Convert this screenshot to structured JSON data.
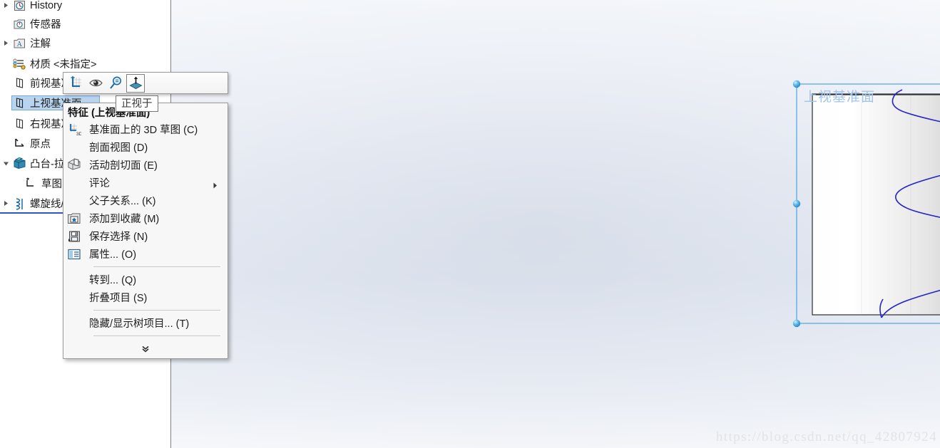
{
  "app": {
    "accent_blue": "#2a56c6",
    "selection_blue": "#b8d5f0",
    "plane_label_color": "#9fc5ee",
    "helix_color": "#2222cc"
  },
  "feature_tree": {
    "name": "FeatureManager design tree",
    "items": [
      {
        "label": "History",
        "icon": "history-icon",
        "expandable": true,
        "expanded": false,
        "indent": 0,
        "selected": false
      },
      {
        "label": "传感器",
        "icon": "sensor-icon",
        "expandable": false,
        "expanded": false,
        "indent": 0,
        "selected": false
      },
      {
        "label": "注解",
        "icon": "annotation-icon",
        "expandable": true,
        "expanded": false,
        "indent": 0,
        "selected": false
      },
      {
        "label": "材质 <未指定>",
        "icon": "material-icon",
        "expandable": false,
        "expanded": false,
        "indent": 0,
        "selected": false
      },
      {
        "label": "前视基准面",
        "icon": "plane-icon",
        "expandable": false,
        "expanded": false,
        "indent": 0,
        "selected": false
      },
      {
        "label": "上视基准面",
        "icon": "plane-icon",
        "expandable": false,
        "expanded": false,
        "indent": 0,
        "selected": true
      },
      {
        "label": "右视基准面",
        "icon": "plane-icon",
        "expandable": false,
        "expanded": false,
        "indent": 0,
        "selected": false
      },
      {
        "label": "原点",
        "icon": "origin-icon",
        "expandable": false,
        "expanded": false,
        "indent": 0,
        "selected": false
      },
      {
        "label": "凸台-拉伸1",
        "icon": "extrude-icon",
        "expandable": true,
        "expanded": true,
        "indent": 0,
        "selected": false
      },
      {
        "label": "草图1",
        "icon": "sketch-icon",
        "expandable": false,
        "expanded": false,
        "indent": 1,
        "selected": false
      },
      {
        "label": "螺旋线/涡状线1",
        "icon": "helix-icon",
        "expandable": true,
        "expanded": false,
        "indent": 0,
        "selected": false
      }
    ]
  },
  "mini_toolbar": {
    "name": "context mini toolbar",
    "buttons": [
      {
        "icon": "sketch-icon",
        "tooltip": "草图绘制",
        "active": false
      },
      {
        "icon": "eye-icon",
        "tooltip": "显示",
        "active": false
      },
      {
        "icon": "magnifier-icon",
        "tooltip": "局部放大",
        "active": false
      },
      {
        "icon": "normal-to-icon",
        "tooltip": "正视于",
        "active": true
      }
    ]
  },
  "tooltip": {
    "text": "正视于"
  },
  "context_menu": {
    "header": "特征 (上视基准面)",
    "items": [
      {
        "label": "基准面上的 3D 草图 (C)",
        "accel": "C",
        "icon": "sketch3d-icon",
        "submenu": false,
        "separator_after": false
      },
      {
        "label": "剖面视图 (D)",
        "accel": "D",
        "icon": "",
        "submenu": false,
        "separator_after": false
      },
      {
        "label": "活动剖切面 (E)",
        "accel": "E",
        "icon": "section-icon",
        "submenu": false,
        "separator_after": false
      },
      {
        "label": "评论",
        "accel": "",
        "icon": "",
        "submenu": true,
        "separator_after": false
      },
      {
        "label": "父子关系... (K)",
        "accel": "K",
        "icon": "",
        "submenu": false,
        "separator_after": false
      },
      {
        "label": "添加到收藏 (M)",
        "accel": "M",
        "icon": "favorite-icon",
        "submenu": false,
        "separator_after": false
      },
      {
        "label": "保存选择 (N)",
        "accel": "N",
        "icon": "save-icon",
        "submenu": false,
        "separator_after": false
      },
      {
        "label": "属性... (O)",
        "accel": "O",
        "icon": "properties-icon",
        "submenu": false,
        "separator_after": true
      },
      {
        "label": "转到... (Q)",
        "accel": "Q",
        "icon": "",
        "submenu": false,
        "separator_after": false
      },
      {
        "label": "折叠项目 (S)",
        "accel": "S",
        "icon": "",
        "submenu": false,
        "separator_after": true
      },
      {
        "label": "隐藏/显示树项目... (T)",
        "accel": "T",
        "icon": "",
        "submenu": false,
        "separator_after": true
      }
    ],
    "expand_chevron": "chevron-double-down-icon"
  },
  "viewport": {
    "plane_label": "上视基准面",
    "selected_entity": "上视基准面",
    "handle_count": 8,
    "helix_turns": 3
  },
  "watermark": {
    "text": "https://blog.csdn.net/qq_42807924"
  }
}
